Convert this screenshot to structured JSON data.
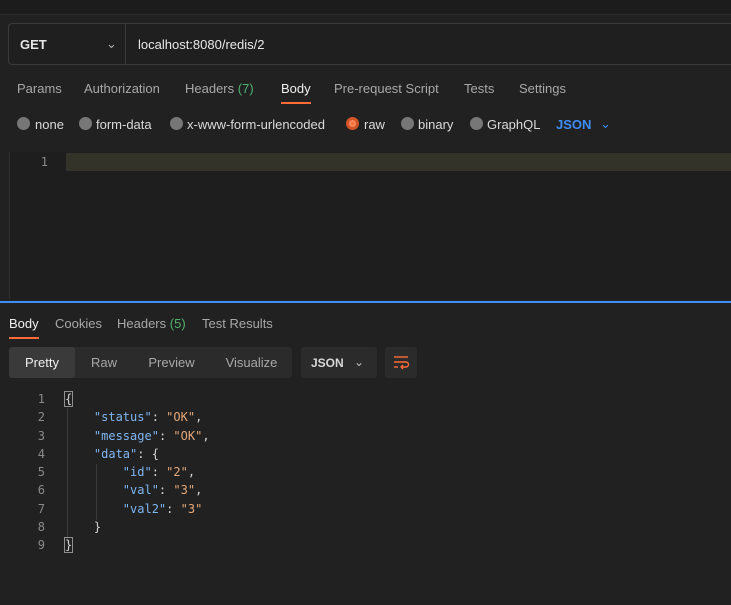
{
  "request": {
    "method": "GET",
    "url": "localhost:8080/redis/2",
    "tabs": [
      {
        "label": "Params",
        "count": ""
      },
      {
        "label": "Authorization",
        "count": ""
      },
      {
        "label": "Headers",
        "count": "(7)"
      },
      {
        "label": "Body",
        "count": ""
      },
      {
        "label": "Pre-request Script",
        "count": ""
      },
      {
        "label": "Tests",
        "count": ""
      },
      {
        "label": "Settings",
        "count": ""
      }
    ],
    "active_tab": "Body",
    "body_types": [
      "none",
      "form-data",
      "x-www-form-urlencoded",
      "raw",
      "binary",
      "GraphQL"
    ],
    "selected_body_type": "raw",
    "format": "JSON",
    "editor_line": "1"
  },
  "response": {
    "tabs": [
      {
        "label": "Body",
        "count": ""
      },
      {
        "label": "Cookies",
        "count": ""
      },
      {
        "label": "Headers",
        "count": "(5)"
      },
      {
        "label": "Test Results",
        "count": ""
      }
    ],
    "active_tab": "Body",
    "views": [
      "Pretty",
      "Raw",
      "Preview",
      "Visualize"
    ],
    "active_view": "Pretty",
    "format": "JSON",
    "line_numbers": [
      "1",
      "2",
      "3",
      "4",
      "5",
      "6",
      "7",
      "8",
      "9"
    ],
    "json": {
      "status": "OK",
      "message": "OK",
      "data": {
        "id": "2",
        "val": "3",
        "val2": "3"
      }
    }
  },
  "icons": {
    "method_dropdown": "chevron-down-icon",
    "format_dropdown": "chevron-down-icon",
    "wrap": "wrap-lines-icon"
  },
  "colors": {
    "accent": "#ff6c37",
    "link": "#3d8ef8",
    "count": "#4eb26b",
    "json_key": "#7fb6f2",
    "json_string": "#e6a87a"
  }
}
